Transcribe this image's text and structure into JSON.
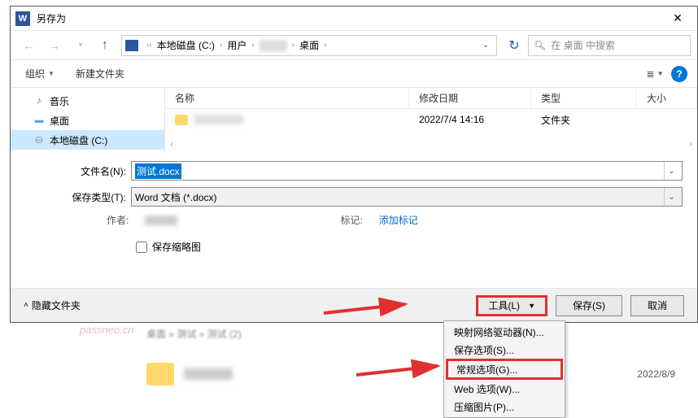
{
  "window": {
    "title": "另存为",
    "app_icon_letter": "W"
  },
  "breadcrumb": {
    "root": "本地磁盘 (C:)",
    "users": "用户",
    "desktop": "桌面"
  },
  "search": {
    "placeholder": "在 桌面 中搜索"
  },
  "toolbar": {
    "organize": "组织",
    "new_folder": "新建文件夹"
  },
  "sidebar": {
    "music": "音乐",
    "desktop": "桌面",
    "local_disk": "本地磁盘 (C:)"
  },
  "columns": {
    "name": "名称",
    "date": "修改日期",
    "type": "类型",
    "size": "大小"
  },
  "file_row": {
    "date": "2022/7/4 14:16",
    "type": "文件夹"
  },
  "form": {
    "filename_label": "文件名(N):",
    "filename_value": "测试.docx",
    "filetype_label": "保存类型(T):",
    "filetype_value": "Word 文档 (*.docx)",
    "author_label": "作者:",
    "tag_label": "标记:",
    "tag_link": "添加标记",
    "thumb_label": "保存缩略图"
  },
  "footer": {
    "hide_folders": "隐藏文件夹",
    "tools": "工具(L)",
    "save": "保存(S)",
    "cancel": "取消"
  },
  "menu": {
    "map_drive": "映射网络驱动器(N)...",
    "save_options": "保存选项(S)...",
    "general_options": "常规选项(G)...",
    "web_options": "Web 选项(W)...",
    "compress_pic": "压缩图片(P)..."
  },
  "behind": {
    "breadcrumb_text": "桌面 » 测试 » 测试 (2)",
    "date2": "2022/8/9"
  },
  "watermark": "passneo.cn"
}
